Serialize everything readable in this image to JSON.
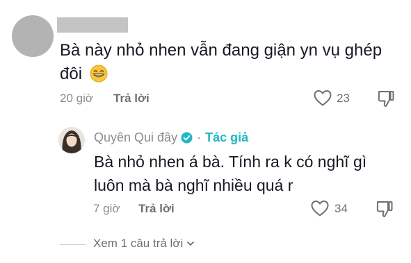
{
  "comment_top": {
    "text": "Bà này nhỏ nhen vẫn đang giận yn vụ ghép đôi",
    "emoji": "grinning-face",
    "time": "20 giờ",
    "reply_label": "Trả lời",
    "likes": "23"
  },
  "reply": {
    "author": "Quyên Qui đây",
    "separator": "·",
    "author_tag": "Tác giả",
    "text": "Bà nhỏ nhen á bà. Tính ra k có nghĩ gì luôn mà bà nghĩ nhiều quá r",
    "time": "7 giờ",
    "reply_label": "Trả lời",
    "likes": "34"
  },
  "view_more": {
    "label": "Xem 1 câu trả lời"
  },
  "colors": {
    "verified": "#20b8c4",
    "tag": "#20b8c4",
    "muted": "#8a8b91"
  }
}
